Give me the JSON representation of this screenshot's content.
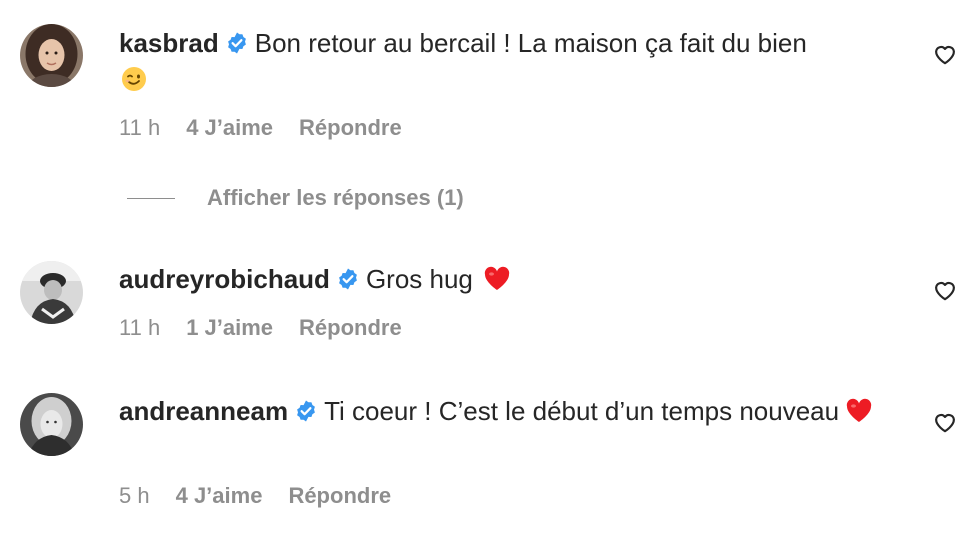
{
  "comments": [
    {
      "username": "kasbrad",
      "text": "Bon retour au bercail ! La maison ça fait du bien",
      "emoji": "😉",
      "time": "11 h",
      "likes": "4 J’aime",
      "reply": "Répondre"
    },
    {
      "username": "audreyrobichaud",
      "text": "Gros hug",
      "emoji": "❤️",
      "time": "11 h",
      "likes": "1 J’aime",
      "reply": "Répondre"
    },
    {
      "username": "andreanneam",
      "text": "Ti coeur ! C’est le début d’un temps nouveau",
      "emoji": "❤️",
      "time": "5 h",
      "likes": "4 J’aime",
      "reply": "Répondre"
    }
  ],
  "replies_toggle": {
    "label": "Afficher les réponses (1)"
  },
  "colors": {
    "text": "#262626",
    "secondary": "#8e8e8e",
    "verified": "#3897f0",
    "heart": "#ed1c24"
  },
  "icons": {
    "verified": "verified-badge-icon",
    "like": "heart-outline-icon"
  }
}
